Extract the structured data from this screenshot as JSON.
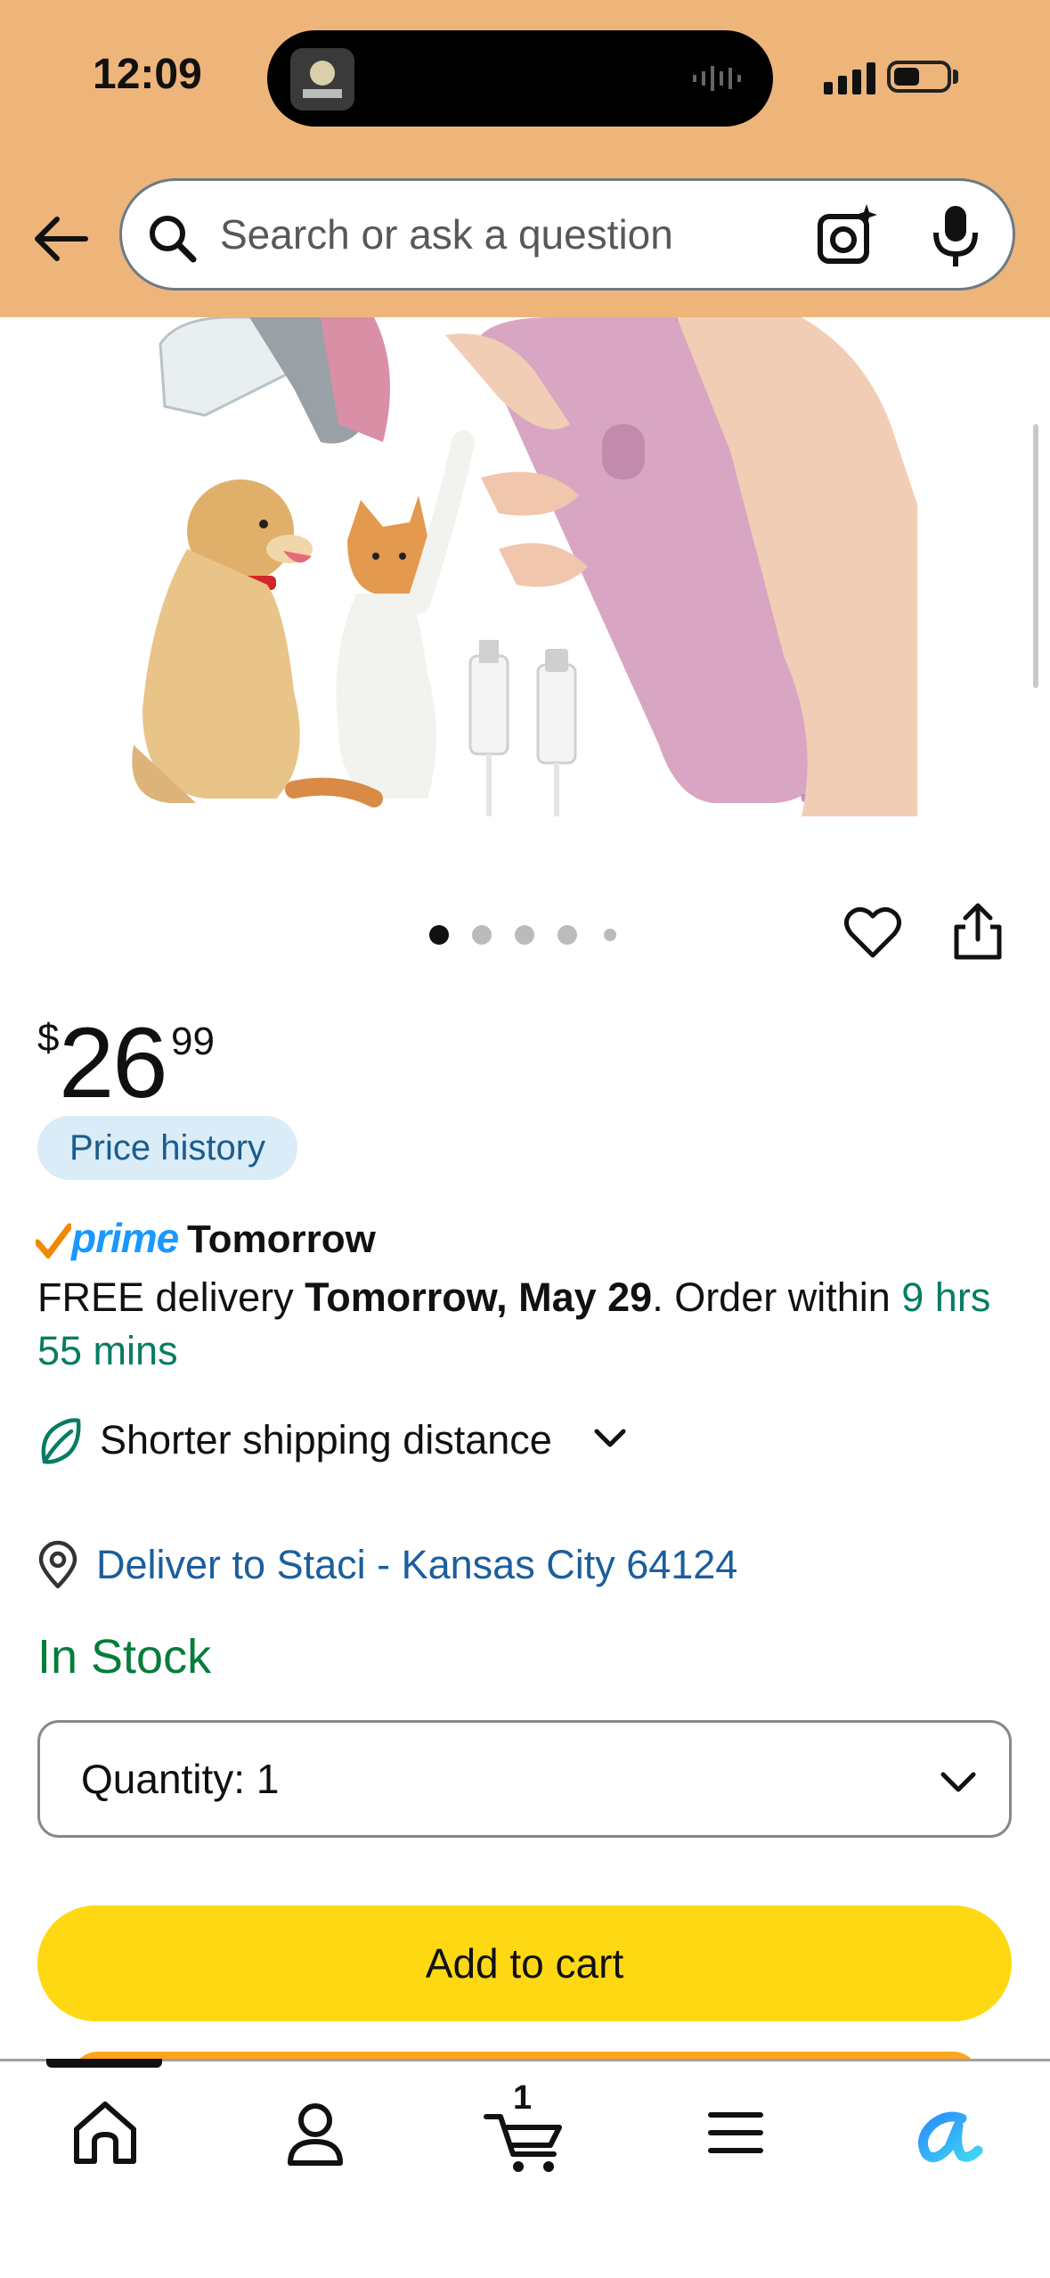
{
  "status": {
    "time": "12:09"
  },
  "search": {
    "placeholder": "Search or ask a question"
  },
  "price": {
    "symbol": "$",
    "whole": "26",
    "fraction": "99"
  },
  "price_history_label": "Price history",
  "prime": {
    "brand": "prime",
    "badge_day": "Tomorrow"
  },
  "delivery": {
    "prefix": "FREE delivery ",
    "date": "Tomorrow, May 29",
    "middle": ". Order within ",
    "countdown": "9 hrs 55 mins"
  },
  "shipping_note": "Shorter shipping distance",
  "deliver_to": "Deliver to Staci - Kansas City 64124",
  "stock_status": "In Stock",
  "quantity": {
    "label": "Quantity:",
    "value": "1"
  },
  "add_to_cart_label": "Add to cart",
  "gallery": {
    "image_count": 5,
    "active_index": 0
  },
  "tabbar": {
    "cart_count": "1",
    "items": [
      "home-icon",
      "account-icon",
      "cart-icon",
      "menu-icon",
      "rufus-ai-icon"
    ]
  },
  "colors": {
    "header": "#eeb57a",
    "cart_button": "#ffd814",
    "prime_blue": "#1a98ff",
    "in_stock": "#067d3b",
    "link": "#1b5e9e"
  }
}
